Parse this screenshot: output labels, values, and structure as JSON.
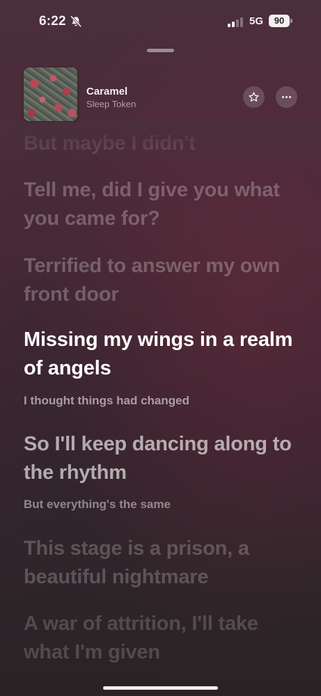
{
  "status_bar": {
    "time": "6:22",
    "network": "5G",
    "battery": "90"
  },
  "now_playing": {
    "title": "Caramel",
    "artist": "Sleep Token"
  },
  "lyrics": [
    {
      "text": "But maybe I didn't",
      "state": "past"
    },
    {
      "text": "Tell me, did I give you what you came for?",
      "state": "past"
    },
    {
      "text": "Terrified to answer my own front door",
      "state": "past"
    },
    {
      "text": "Missing my wings in a realm of angels",
      "state": "active"
    },
    {
      "text": "I thought things had changed",
      "state": "background-vocal"
    },
    {
      "text": "So I'll keep dancing along to the rhythm",
      "state": "upcoming"
    },
    {
      "text": "But everything's the same",
      "state": "background-vocal"
    },
    {
      "text": "This stage is a prison, a beautiful nightmare",
      "state": "upcoming"
    },
    {
      "text": "A war of attrition, I'll take what I'm given",
      "state": "upcoming"
    }
  ],
  "icons": {
    "silent": "bell-slash-icon",
    "signal": "cellular-signal-icon",
    "battery": "battery-icon",
    "favorite": "star-icon",
    "more": "ellipsis-icon"
  },
  "colors": {
    "background_top": "#4a2e3c",
    "background_bottom": "#2a2326",
    "active_lyric": "#ffffff"
  }
}
